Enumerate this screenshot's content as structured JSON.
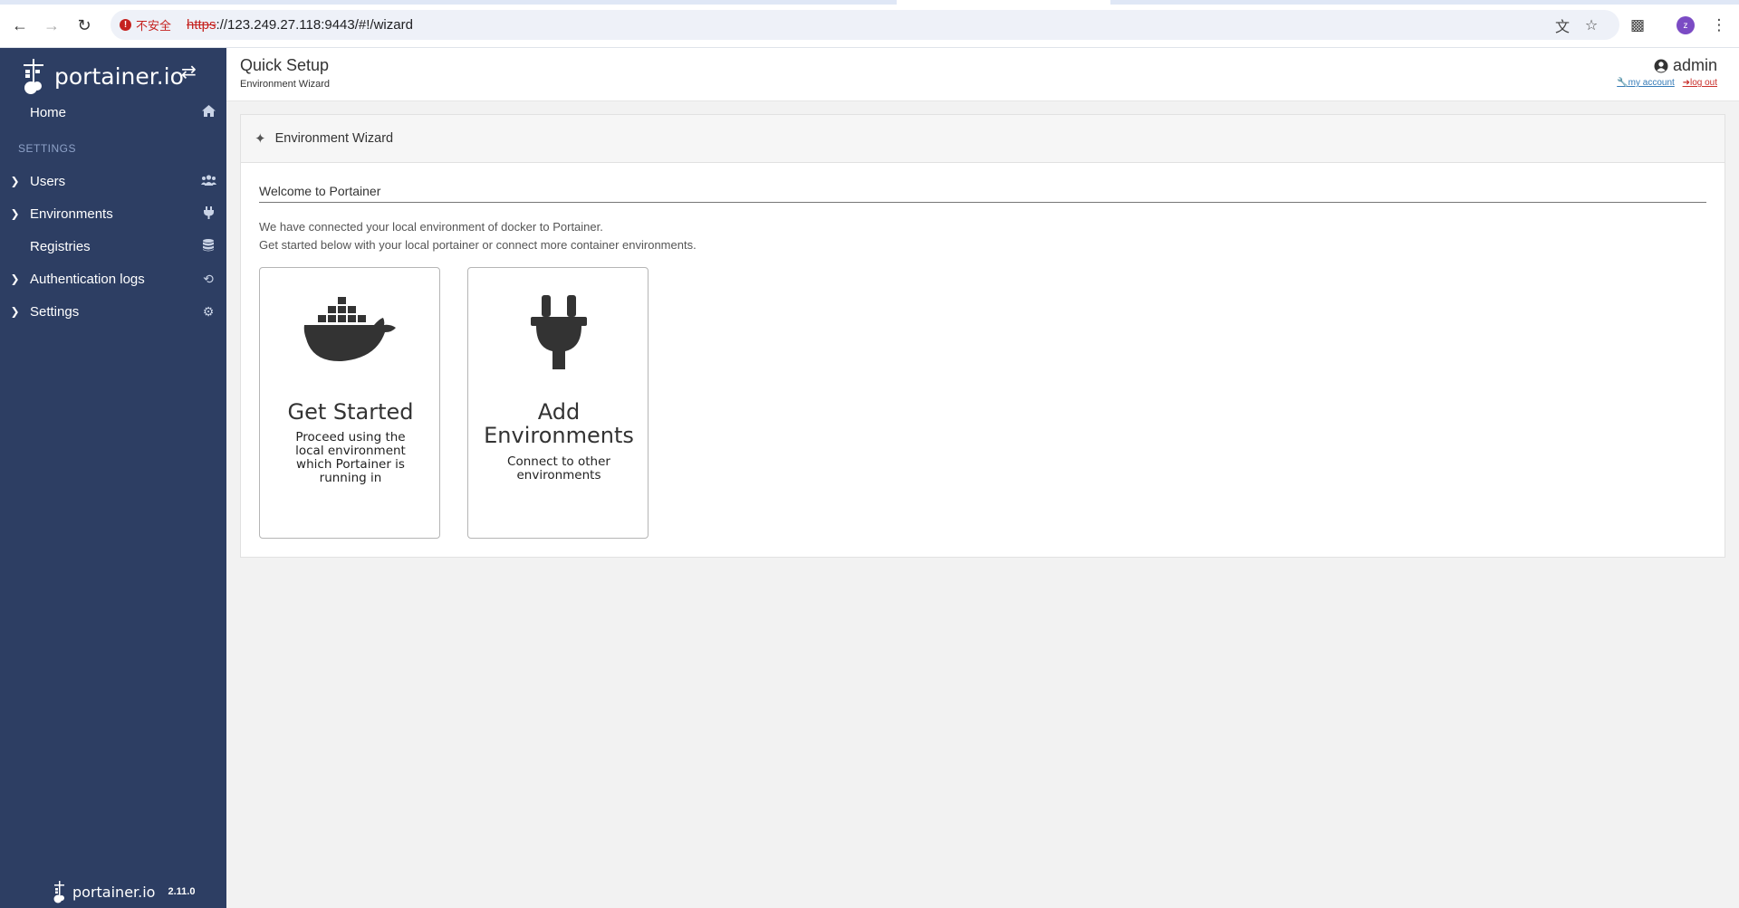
{
  "browser": {
    "security_label": "不安全",
    "url_scheme": "https",
    "url_rest": "://123.249.27.118:9443/#!/wizard",
    "profile_initial": "z"
  },
  "sidebar": {
    "brand": "portainer.io",
    "section_label": "SETTINGS",
    "items": [
      {
        "label": "Home",
        "icon": "home-icon",
        "expandable": false
      },
      {
        "label": "Users",
        "icon": "users-icon",
        "expandable": true
      },
      {
        "label": "Environments",
        "icon": "plug-icon",
        "expandable": true
      },
      {
        "label": "Registries",
        "icon": "database-icon",
        "expandable": false
      },
      {
        "label": "Authentication logs",
        "icon": "history-icon",
        "expandable": true
      },
      {
        "label": "Settings",
        "icon": "cogs-icon",
        "expandable": true
      }
    ],
    "footer_brand": "portainer.io",
    "version": "2.11.0"
  },
  "header": {
    "title": "Quick Setup",
    "subtitle": "Environment Wizard",
    "username": "admin",
    "my_account": "my account",
    "log_out": "log out"
  },
  "wizard": {
    "panel_title": "Environment Wizard",
    "section_title": "Welcome to Portainer",
    "intro_line1": "We have connected your local environment of docker to Portainer.",
    "intro_line2": "Get started below with your local portainer or connect more container environments.",
    "options": [
      {
        "title": "Get Started",
        "description": "Proceed using the local environment which Portainer is running in",
        "icon": "docker-whale-icon"
      },
      {
        "title": "Add Environments",
        "description": "Connect to other environments",
        "icon": "plug-icon"
      }
    ]
  }
}
